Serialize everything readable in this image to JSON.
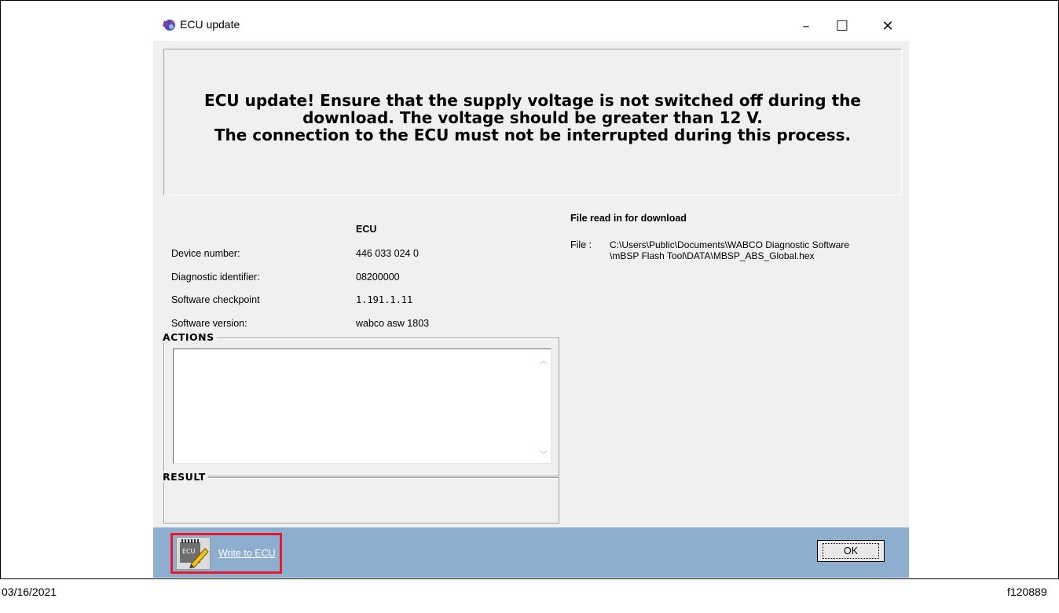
{
  "window": {
    "title": "ECU update",
    "controls": {
      "minimize": "–",
      "maximize": "☐",
      "close": "✕"
    }
  },
  "banner": {
    "lines": [
      "ECU update! Ensure that the supply voltage is not switched off during the",
      "download. The voltage should be greater than 12 V.",
      "The connection to the ECU must not be interrupted during this process."
    ]
  },
  "ecu_info": {
    "header": "ECU",
    "rows": [
      {
        "label": "Device number:",
        "value": "446 033 024 0"
      },
      {
        "label": "Diagnostic identifier:",
        "value": "08200000"
      },
      {
        "label": "Software checkpoint",
        "value": "1.191.1.11"
      },
      {
        "label": "Software version:",
        "value": "wabco asw 1803"
      }
    ]
  },
  "file_info": {
    "header": "File read in for download",
    "label": "File :",
    "path_line1": "C:\\Users\\Public\\Documents\\WABCO Diagnostic Software",
    "path_line2": "\\mBSP Flash Tool\\DATA\\MBSP_ABS_Global.hex"
  },
  "actions": {
    "title": "ACTIONS",
    "content": ""
  },
  "result": {
    "title": "RESULT",
    "content": ""
  },
  "bottom_bar": {
    "write_button_label": "Write to ECU",
    "ok_button_label": "OK",
    "highlight_color": "#e8192c",
    "bar_color": "#8eaecf"
  },
  "footer": {
    "date": "03/16/2021",
    "figure_id": "f120889"
  }
}
